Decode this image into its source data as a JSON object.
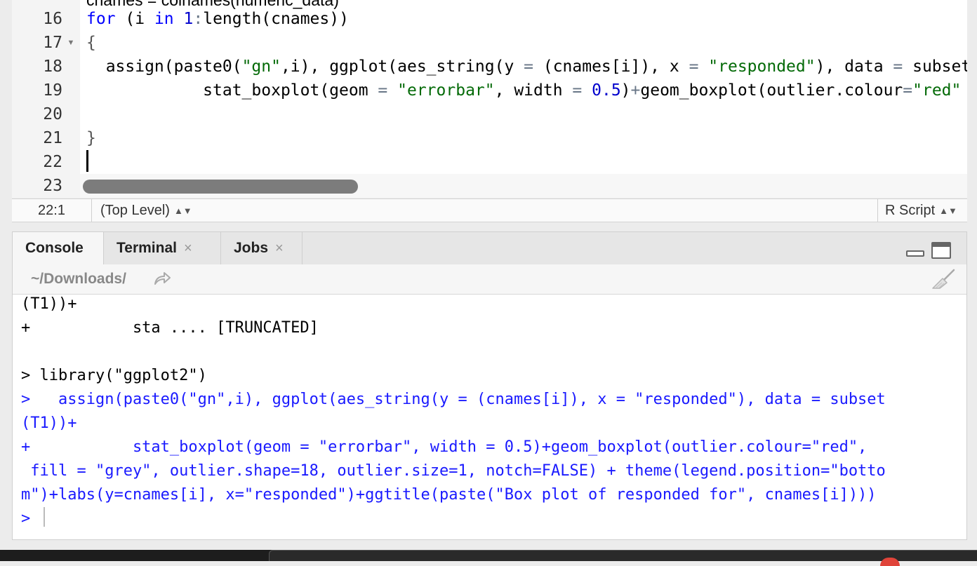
{
  "editor": {
    "line_numbers": [
      "16",
      "17",
      "18",
      "19",
      "20",
      "21",
      "22",
      "23"
    ],
    "top_partial_line": "cnames = colnames(numeric_data)",
    "lines": [
      [
        {
          "t": "for",
          "c": "kw"
        },
        {
          "t": " (i ",
          "c": ""
        },
        {
          "t": "in",
          "c": "kw"
        },
        {
          "t": " ",
          "c": ""
        },
        {
          "t": "1",
          "c": "nm"
        },
        {
          "t": ":",
          "c": "op"
        },
        {
          "t": "length(cnames))",
          "c": ""
        }
      ],
      [
        {
          "t": "{",
          "c": "pn"
        }
      ],
      [
        {
          "t": "  assign(paste0(",
          "c": ""
        },
        {
          "t": "\"gn\"",
          "c": "st"
        },
        {
          "t": ",i), ggplot(aes_string(y ",
          "c": ""
        },
        {
          "t": "=",
          "c": "op"
        },
        {
          "t": " (cnames[i]), x ",
          "c": ""
        },
        {
          "t": "=",
          "c": "op"
        },
        {
          "t": " ",
          "c": ""
        },
        {
          "t": "\"responded\"",
          "c": "st"
        },
        {
          "t": "), data ",
          "c": ""
        },
        {
          "t": "=",
          "c": "op"
        },
        {
          "t": " subset",
          "c": ""
        }
      ],
      [
        {
          "t": "            stat_boxplot(geom ",
          "c": ""
        },
        {
          "t": "=",
          "c": "op"
        },
        {
          "t": " ",
          "c": ""
        },
        {
          "t": "\"errorbar\"",
          "c": "st"
        },
        {
          "t": ", width ",
          "c": ""
        },
        {
          "t": "=",
          "c": "op"
        },
        {
          "t": " ",
          "c": ""
        },
        {
          "t": "0.5",
          "c": "nm"
        },
        {
          "t": ")",
          "c": ""
        },
        {
          "t": "+",
          "c": "op"
        },
        {
          "t": "geom_boxplot(outlier.colour",
          "c": ""
        },
        {
          "t": "=",
          "c": "op"
        },
        {
          "t": "\"red\"",
          "c": "st"
        }
      ],
      [],
      [
        {
          "t": "}",
          "c": "pn"
        }
      ],
      [],
      []
    ]
  },
  "statusbar": {
    "position": "22:1",
    "scope": "(Top Level)",
    "file_type": "R Script"
  },
  "console": {
    "tabs": [
      {
        "label": "Console",
        "closable": false
      },
      {
        "label": "Terminal",
        "closable": true
      },
      {
        "label": "Jobs",
        "closable": true
      }
    ],
    "close_glyph": "×",
    "path": "~/Downloads/",
    "lines": [
      {
        "text": "(T1))+",
        "color": "black"
      },
      {
        "text": "+           sta .... [TRUNCATED]",
        "color": "black"
      },
      {
        "text": "",
        "color": "black"
      },
      {
        "text": "> library(\"ggplot2\")",
        "color": "black"
      },
      {
        "text": ">   assign(paste0(\"gn\",i), ggplot(aes_string(y = (cnames[i]), x = \"responded\"), data = subset",
        "color": "blue"
      },
      {
        "text": "(T1))+",
        "color": "blue"
      },
      {
        "text": "+           stat_boxplot(geom = \"errorbar\", width = 0.5)+geom_boxplot(outlier.colour=\"red\",",
        "color": "blue"
      },
      {
        "text": " fill = \"grey\", outlier.shape=18, outlier.size=1, notch=FALSE) + theme(legend.position=\"botto",
        "color": "blue"
      },
      {
        "text": "m\")+labs(y=cnames[i], x=\"responded\")+ggtitle(paste(\"Box plot of responded for\", cnames[i])))",
        "color": "blue"
      },
      {
        "text": ">",
        "color": "blue"
      }
    ]
  },
  "colors": {
    "keyword": "#0000ff",
    "string": "#036a07",
    "number": "#0000cd",
    "console_input": "#1a1aff"
  }
}
